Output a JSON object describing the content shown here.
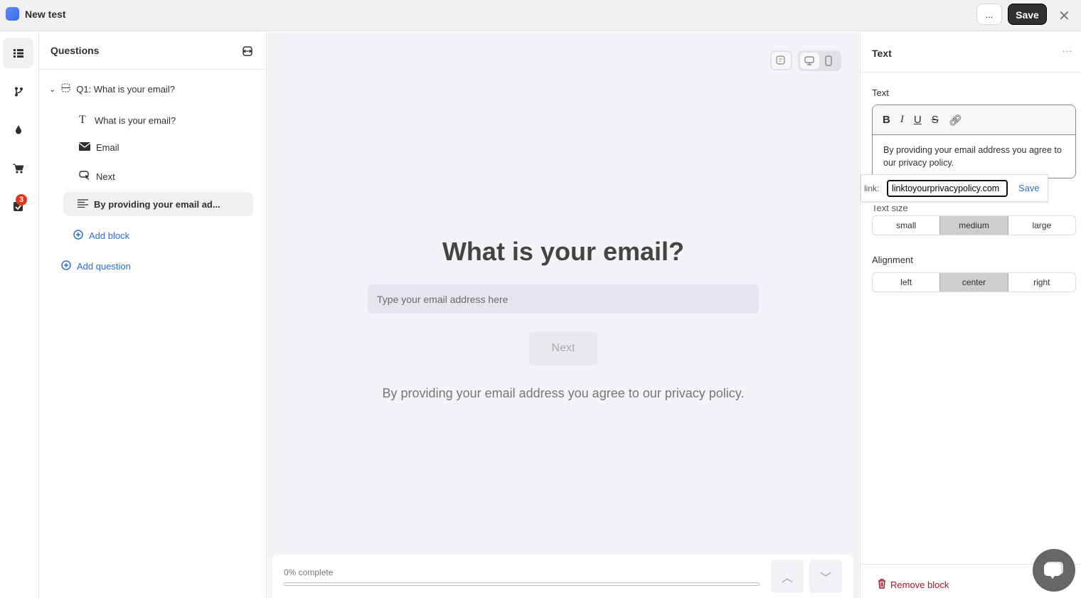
{
  "app": {
    "title": "New test",
    "more_label": "...",
    "save_label": "Save",
    "close_icon": "close-icon"
  },
  "rail": {
    "items": [
      "questions-icon",
      "branch-icon",
      "theme-drop-icon",
      "cart-icon",
      "checklist-icon"
    ],
    "badge": "3"
  },
  "questions": {
    "title": "Questions",
    "q1": "Q1: What is your email?",
    "blocks": [
      {
        "icon": "text-heading-icon",
        "label": "What is your email?"
      },
      {
        "icon": "email-icon",
        "label": "Email"
      },
      {
        "icon": "button-cursor-icon",
        "label": "Next"
      },
      {
        "icon": "paragraph-icon",
        "label": "By providing your email ad...",
        "selected": true
      }
    ],
    "add_block": "Add block",
    "add_question": "Add question"
  },
  "preview": {
    "title": "What is your email?",
    "email_placeholder": "Type your email address here",
    "next_label": "Next",
    "privacy_text": "By providing your email address you agree to our privacy policy.",
    "progress_text": "0% complete",
    "progress_percent": 0,
    "device": "desktop"
  },
  "props": {
    "title": "Text",
    "more": "...",
    "text_label": "Text",
    "editor_text": "By providing your email address you agree to our privacy policy.",
    "link_label": "link:",
    "link_value": "linktoyourprivacypolicy.com",
    "link_save": "Save",
    "size_label": "Text size",
    "sizes": [
      "small",
      "medium",
      "large"
    ],
    "size_selected": "medium",
    "align_label": "Alignment",
    "aligns": [
      "left",
      "center",
      "right"
    ],
    "align_selected": "center",
    "remove_label": "Remove block"
  },
  "colors": {
    "accent": "#2c6ecb",
    "danger": "#a1172f",
    "badge": "#e5361b",
    "dark": "#303030"
  }
}
